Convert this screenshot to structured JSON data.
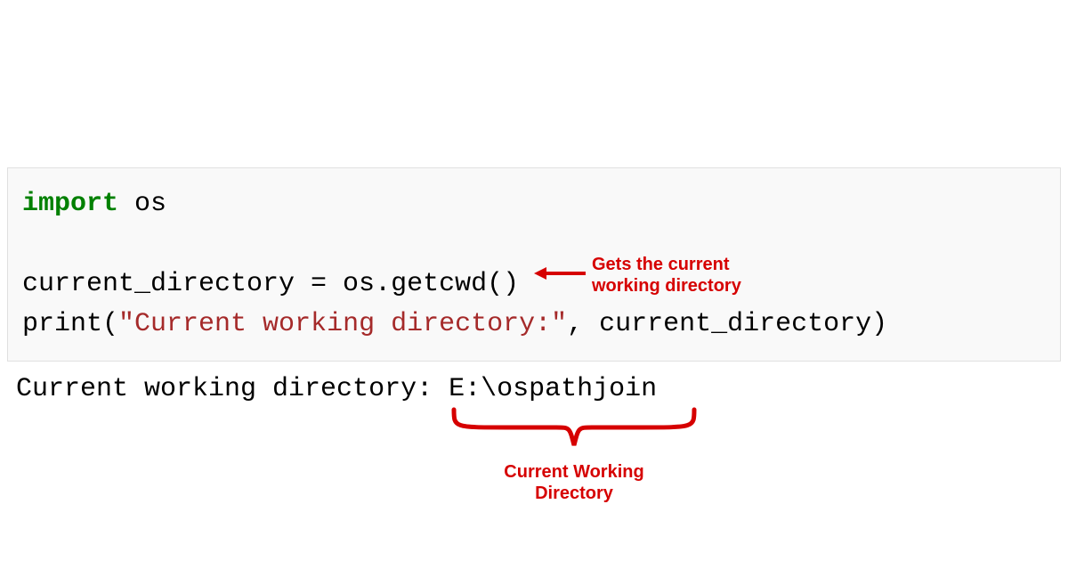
{
  "code": {
    "line1": {
      "kw": "import",
      "rest": " os"
    },
    "line2": "current_directory = os.getcwd()",
    "line3": {
      "prefix": "print(",
      "string": "\"Current working directory:\"",
      "suffix": ", current_directory)"
    }
  },
  "output": "Current working directory: E:\\ospathjoin",
  "annotations": {
    "arrow1_line1": "Gets the current",
    "arrow1_line2": "working directory",
    "brace_line1": "Current Working",
    "brace_line2": "Directory"
  },
  "colors": {
    "annotation": "#d60000",
    "keyword": "#008000",
    "string": "#a52a2a"
  }
}
